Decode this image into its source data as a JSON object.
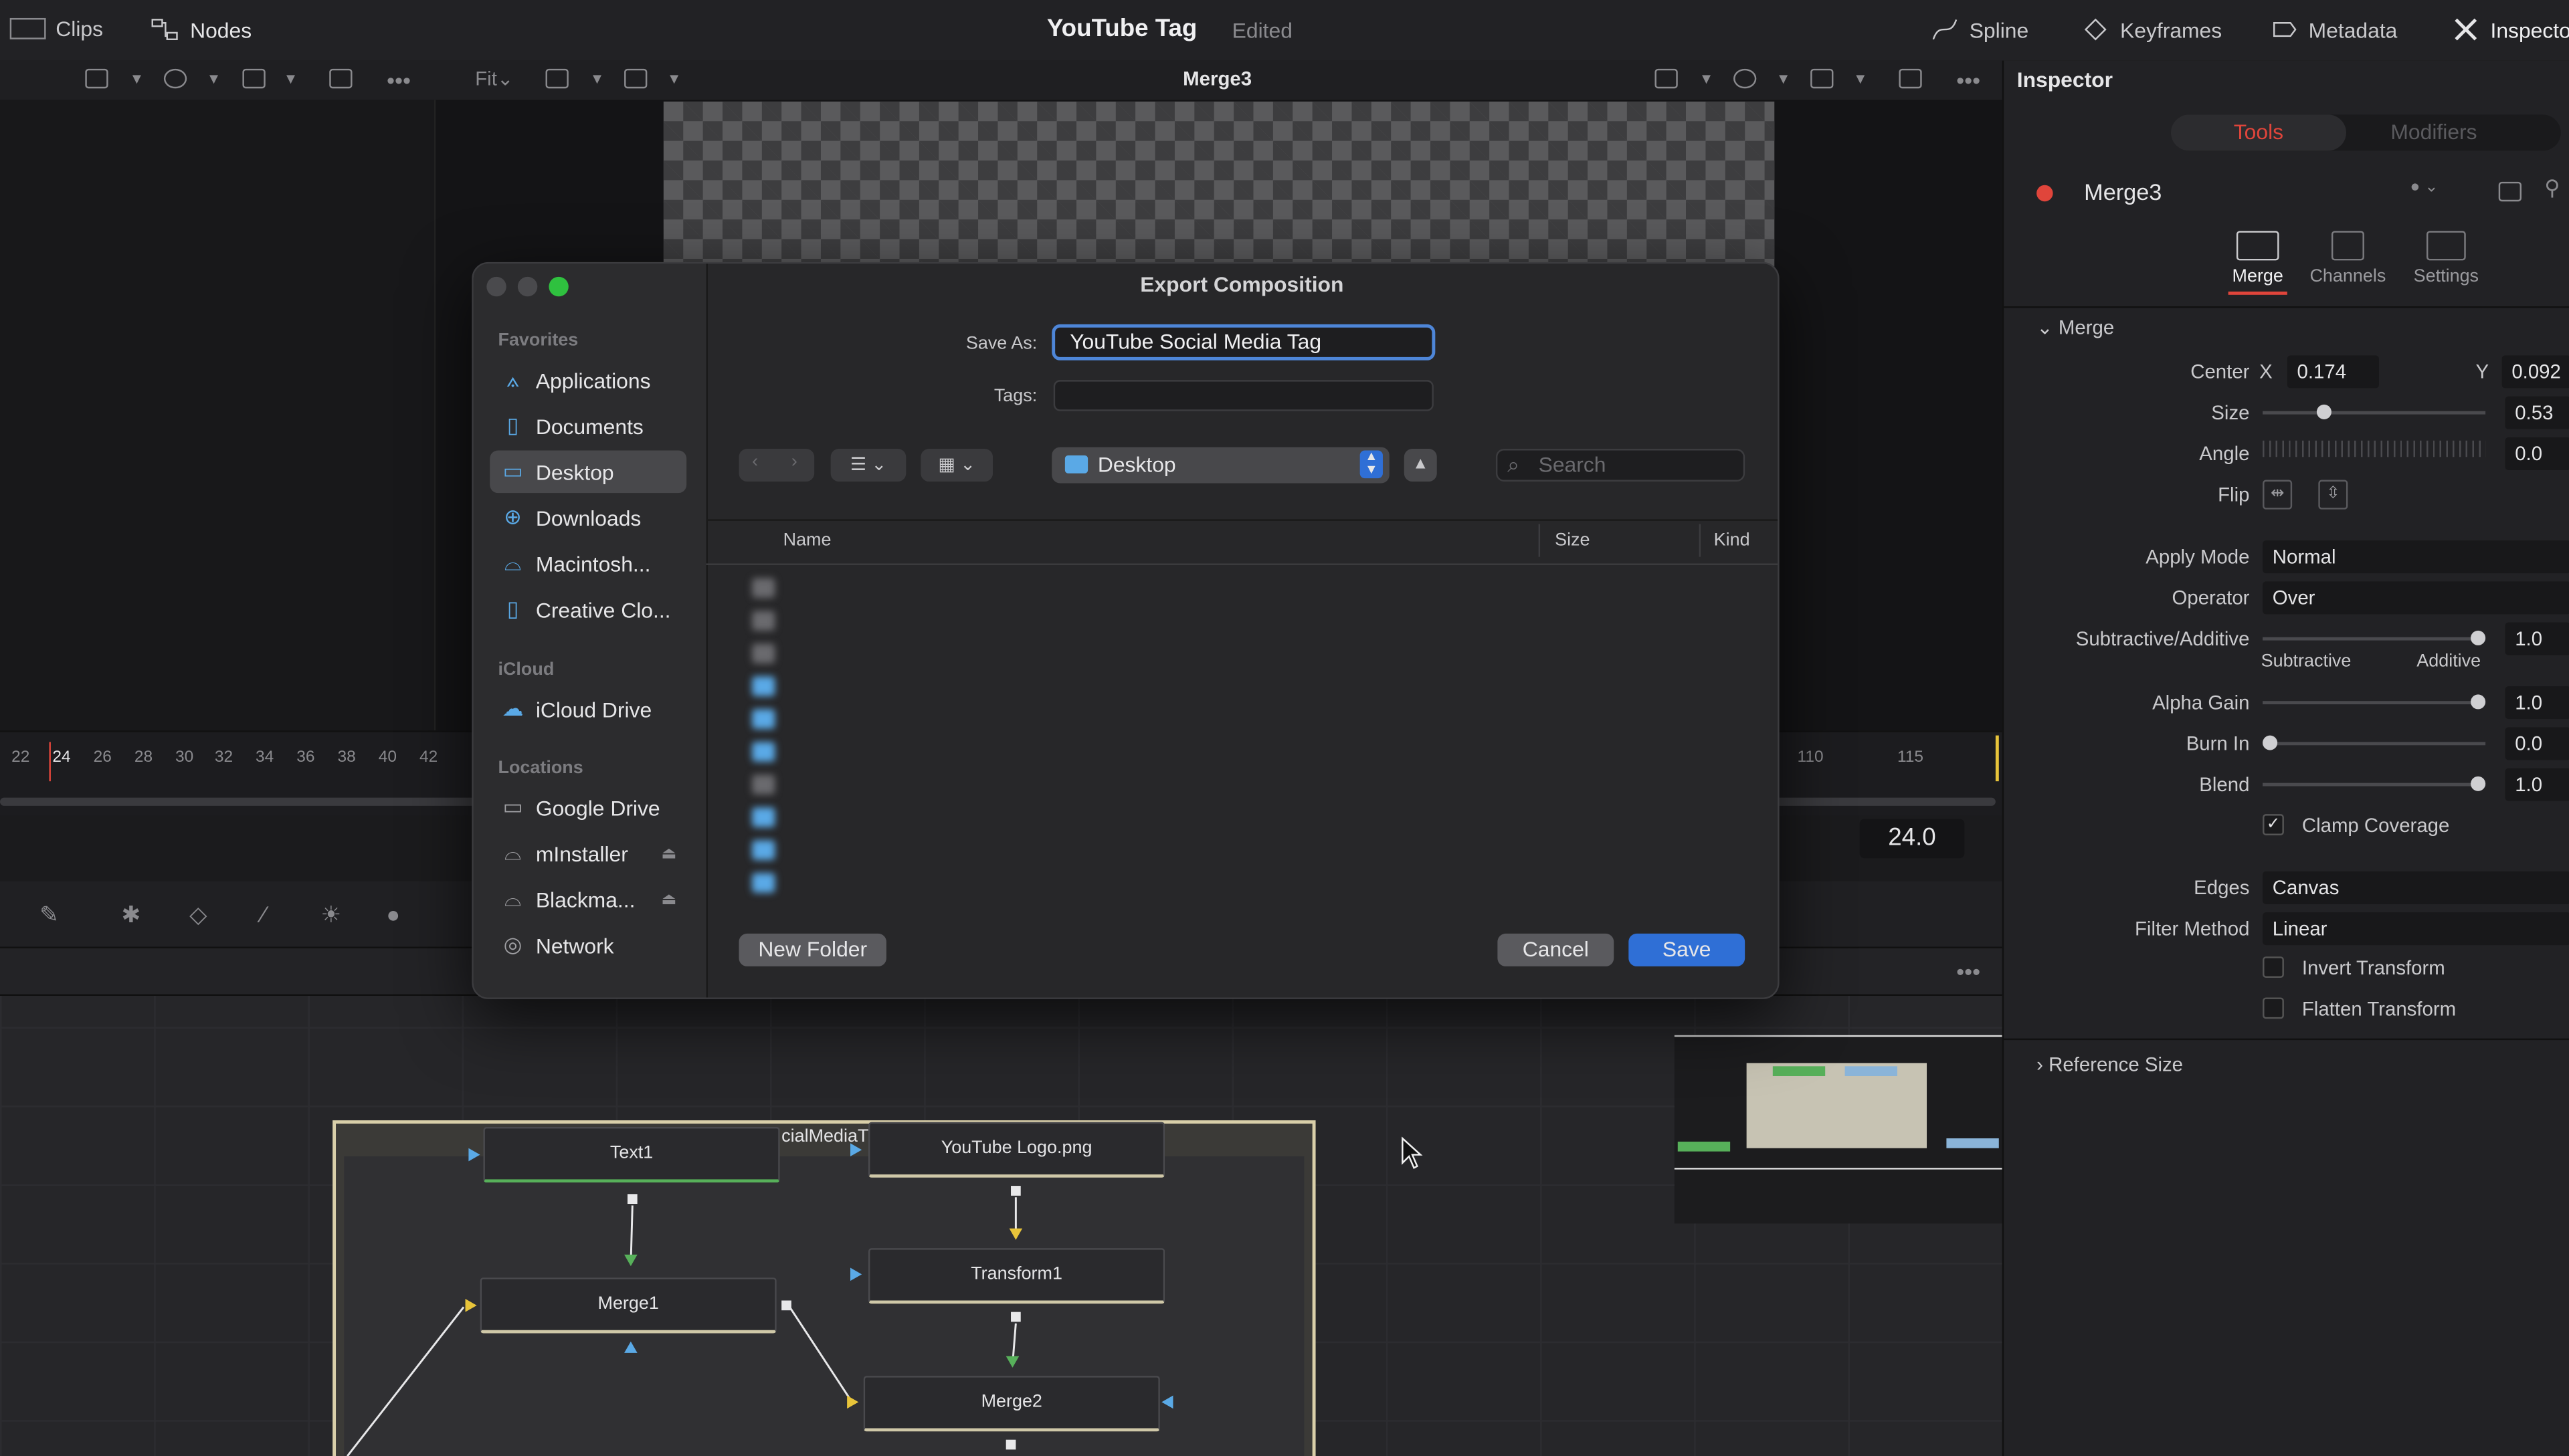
{
  "topbar": {
    "clips": "Clips",
    "nodes": "Nodes",
    "title": "YouTube Tag",
    "edited": "Edited",
    "spline": "Spline",
    "keyframes": "Keyframes",
    "metadata": "Metadata",
    "inspector": "Inspecto"
  },
  "viewer": {
    "fit": "Fit",
    "name": "Merge3"
  },
  "timeline": {
    "ticks": [
      "22",
      "24",
      "26",
      "28",
      "30",
      "32",
      "34",
      "36",
      "38",
      "40",
      "42",
      "110",
      "115"
    ],
    "frame": "24.0"
  },
  "nodes": {
    "text1": "Text1",
    "youtube_logo": "YouTube Logo.png",
    "transform1": "Transform1",
    "merge1": "Merge1",
    "merge2": "Merge2",
    "group_label": "cialMediaT"
  },
  "inspector": {
    "title": "Inspector",
    "tab_tools": "Tools",
    "tab_modifiers": "Modifiers",
    "node_name": "Merge3",
    "subtab_merge": "Merge",
    "subtab_channels": "Channels",
    "subtab_settings": "Settings",
    "section_merge": "Merge",
    "center_label": "Center",
    "x_label": "X",
    "center_x": "0.174",
    "y_label": "Y",
    "center_y": "0.092",
    "size_label": "Size",
    "size_value": "0.53",
    "angle_label": "Angle",
    "angle_value": "0.0",
    "flip_label": "Flip",
    "apply_mode_label": "Apply Mode",
    "apply_mode": "Normal",
    "operator_label": "Operator",
    "operator": "Over",
    "subadd_label": "Subtractive/Additive",
    "subadd_value": "1.0",
    "subtractive": "Subtractive",
    "additive": "Additive",
    "alpha_gain_label": "Alpha Gain",
    "alpha_gain": "1.0",
    "burn_in_label": "Burn In",
    "burn_in": "0.0",
    "blend_label": "Blend",
    "blend": "1.0",
    "clamp_coverage": "Clamp Coverage",
    "edges_label": "Edges",
    "edges": "Canvas",
    "filter_method_label": "Filter Method",
    "filter_method": "Linear",
    "invert_transform": "Invert Transform",
    "flatten_transform": "Flatten Transform",
    "reference_size": "Reference Size"
  },
  "dialog": {
    "title": "Export Composition",
    "save_as_label": "Save As:",
    "save_as_value": "YouTube Social Media Tag",
    "tags_label": "Tags:",
    "location": "Desktop",
    "search_placeholder": "Search",
    "col_name": "Name",
    "col_size": "Size",
    "col_kind": "Kind",
    "new_folder": "New Folder",
    "cancel": "Cancel",
    "save": "Save",
    "sidebar": {
      "favorites": "Favorites",
      "items_fav": [
        "Applications",
        "Documents",
        "Desktop",
        "Downloads",
        "Macintosh...",
        "Creative Clo..."
      ],
      "icloud": "iCloud",
      "icloud_drive": "iCloud Drive",
      "locations": "Locations",
      "items_loc": [
        "Google Drive",
        "mInstaller",
        "Blackma...",
        "Network"
      ]
    }
  },
  "colors": {
    "accent_blue": "#2f6fd6",
    "tools_red": "#e0453b",
    "traffic_green": "#2fc13f"
  }
}
